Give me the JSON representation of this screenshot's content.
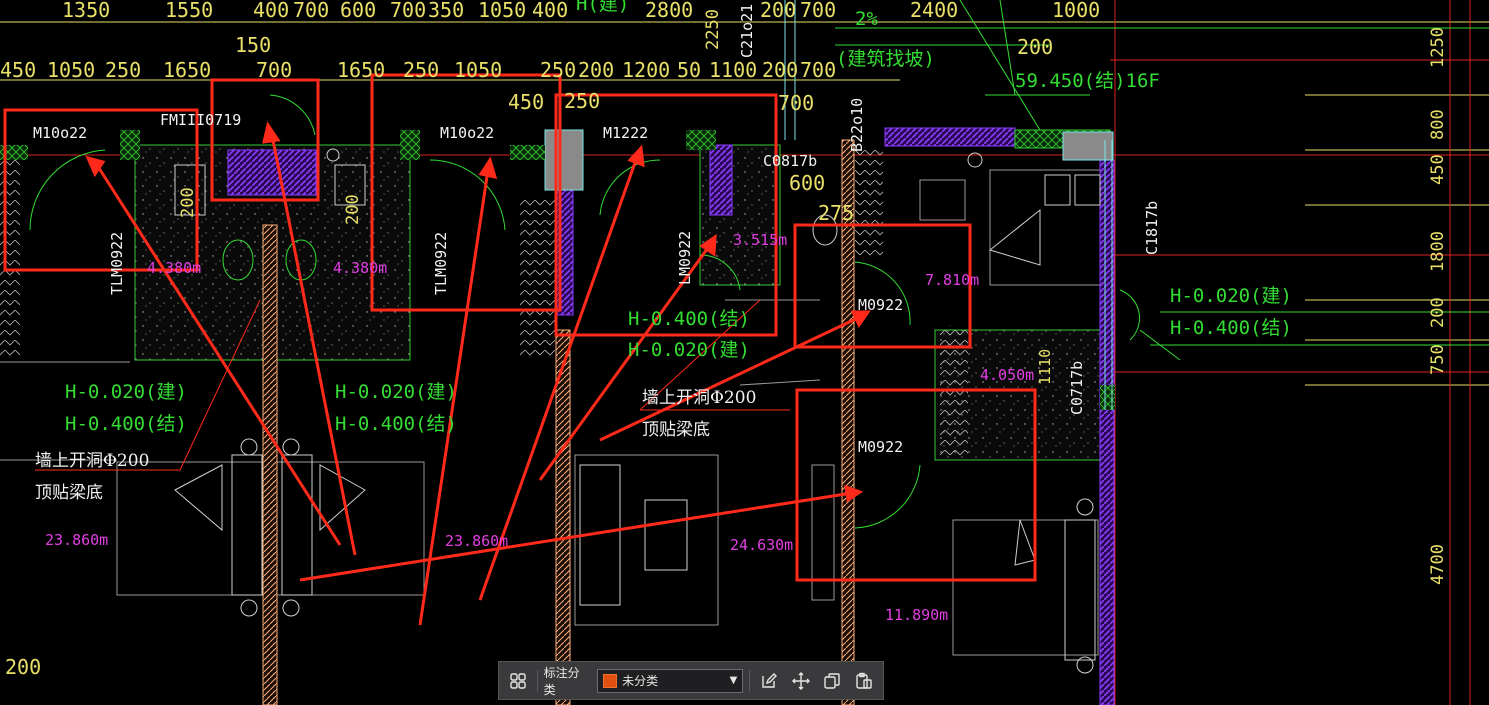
{
  "colors": {
    "background": "#000000",
    "dimension": "#e8e068",
    "note": "#33dd33",
    "area": "#e23ee2",
    "markup": "#ff2a1a",
    "wall": "#ffb07a",
    "cyan_line": "#7be5e5",
    "purple_hatch": "#8b3dff",
    "swatch": "#e05010"
  },
  "dims_top": [
    "1350",
    "1550",
    "400",
    "700",
    "600",
    "700",
    "350",
    "1050",
    "400",
    "H(建)",
    "2800",
    "200",
    "700",
    "2%",
    "2400",
    "1000"
  ],
  "dims_row2": [
    "450",
    "1050",
    "250",
    "1650",
    "700",
    "1650",
    "250",
    "1050",
    "250",
    "200",
    "1200",
    "50",
    "1100",
    "200",
    "700",
    "200"
  ],
  "dims_misc": [
    "150",
    "450",
    "250",
    "2250",
    "C21o21",
    "700",
    "600",
    "275",
    "200",
    "200",
    "200",
    "1110"
  ],
  "dims_right": [
    "1250",
    "800",
    "450",
    "1800",
    "200",
    "750",
    "4700"
  ],
  "elevations": {
    "slope": "(建筑找坡)",
    "level_16f": "59.450(结)16F",
    "left_h1": "H-0.020(建)",
    "left_h2": "H-0.400(结)",
    "mid_h1": "H-0.020(建)",
    "mid_h2": "H-0.400(结)",
    "center_h1": "H-0.400(结)",
    "center_h2": "H-0.020(建)",
    "right_h1": "H-0.020(建)",
    "right_h2": "H-0.400(结)"
  },
  "door_labels": [
    "M10o22",
    "FMIII0719",
    "M10o22",
    "M1222",
    "M0922",
    "M0922",
    "TLM0922",
    "TLM0922",
    "LM0922",
    "C0817b",
    "C1817b",
    "C0717b",
    "B22o10"
  ],
  "notes": {
    "left_line1": "墙上开洞Φ200",
    "left_line2": "顶贴梁底",
    "mid_line1": "墙上开洞Φ200",
    "mid_line2": "顶贴梁底"
  },
  "areas": [
    "4.380m",
    "4.380m",
    "3.515m",
    "7.810m",
    "4.050m",
    "23.860m",
    "23.860m",
    "24.630m",
    "11.890m"
  ],
  "toolbar": {
    "label": "标注分类",
    "selected_category": "未分类",
    "buttons": [
      "grid-icon",
      "edit-icon",
      "move-icon",
      "copy-icon",
      "paste-icon"
    ]
  }
}
